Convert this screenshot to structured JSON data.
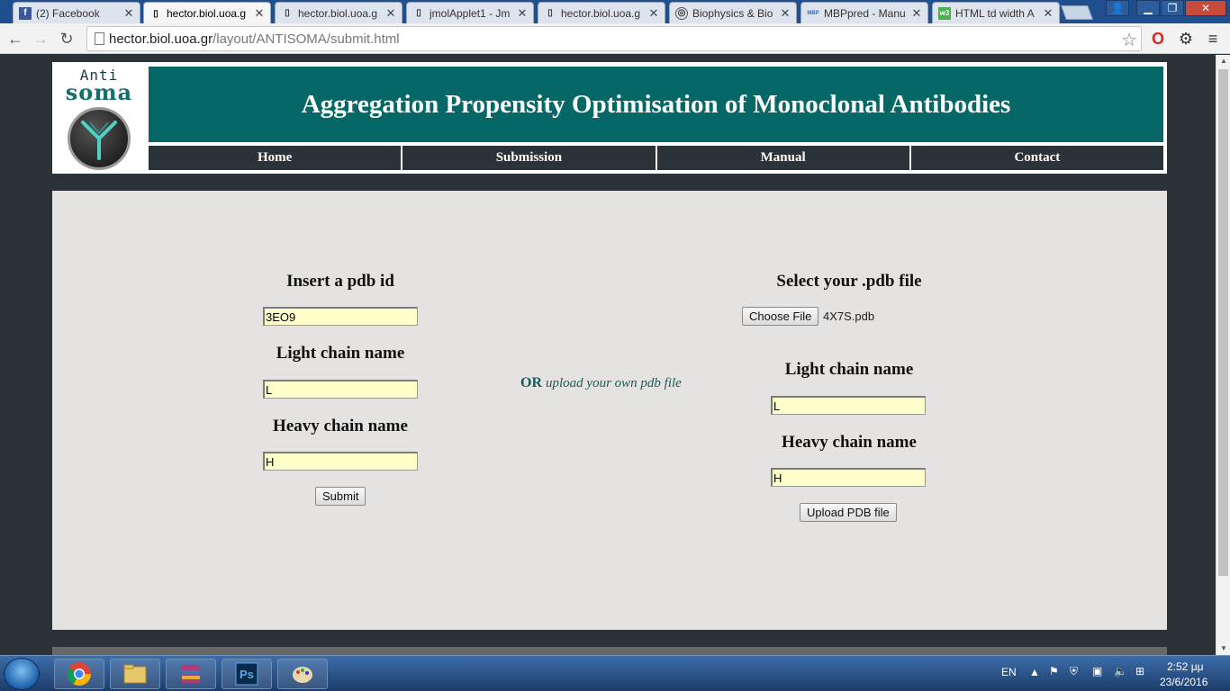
{
  "browser": {
    "tabs": [
      {
        "title": "(2) Facebook",
        "icon": "facebook-icon"
      },
      {
        "title": "hector.biol.uoa.g",
        "icon": "page-icon",
        "active": true
      },
      {
        "title": "hector.biol.uoa.g",
        "icon": "page-icon"
      },
      {
        "title": "jmolApplet1 - Jm",
        "icon": "page-icon"
      },
      {
        "title": "hector.biol.uoa.g",
        "icon": "page-icon"
      },
      {
        "title": "Biophysics & Bio",
        "icon": "globe-icon"
      },
      {
        "title": "MBPpred - Manu",
        "icon": "mbppred-icon"
      },
      {
        "title": "HTML td width A",
        "icon": "w3schools-icon"
      }
    ],
    "url_host": "hector.biol.uoa.gr",
    "url_path": "/layout/ANTISOMA/submit.html"
  },
  "site": {
    "logo_top": "Anti",
    "logo_bottom": "soma",
    "banner_title": "Aggregation Propensity Optimisation of Monoclonal Antibodies",
    "menu": [
      "Home",
      "Submission",
      "Manual",
      "Contact"
    ]
  },
  "form_pdb_id": {
    "title": "Insert a pdb id",
    "pdb_id_value": "3EO9",
    "light_chain_label": "Light chain name",
    "light_chain_value": "L",
    "heavy_chain_label": "Heavy chain name",
    "heavy_chain_value": "H",
    "submit_label": "Submit"
  },
  "separator": {
    "or": "OR",
    "text": "upload your own pdb file"
  },
  "form_upload": {
    "title": "Select your .pdb file",
    "choose_file_label": "Choose File",
    "file_name": "4X7S.pdb",
    "light_chain_label": "Light chain name",
    "light_chain_value": "L",
    "heavy_chain_label": "Heavy chain name",
    "heavy_chain_value": "H",
    "upload_label": "Upload PDB file"
  },
  "taskbar": {
    "lang": "EN",
    "time": "2:52 μμ",
    "date": "23/6/2016"
  },
  "colors": {
    "banner": "#066866",
    "page_bg": "#2b3238",
    "content_bg": "#e5e3e1",
    "field_bg": "#ffffcc"
  }
}
